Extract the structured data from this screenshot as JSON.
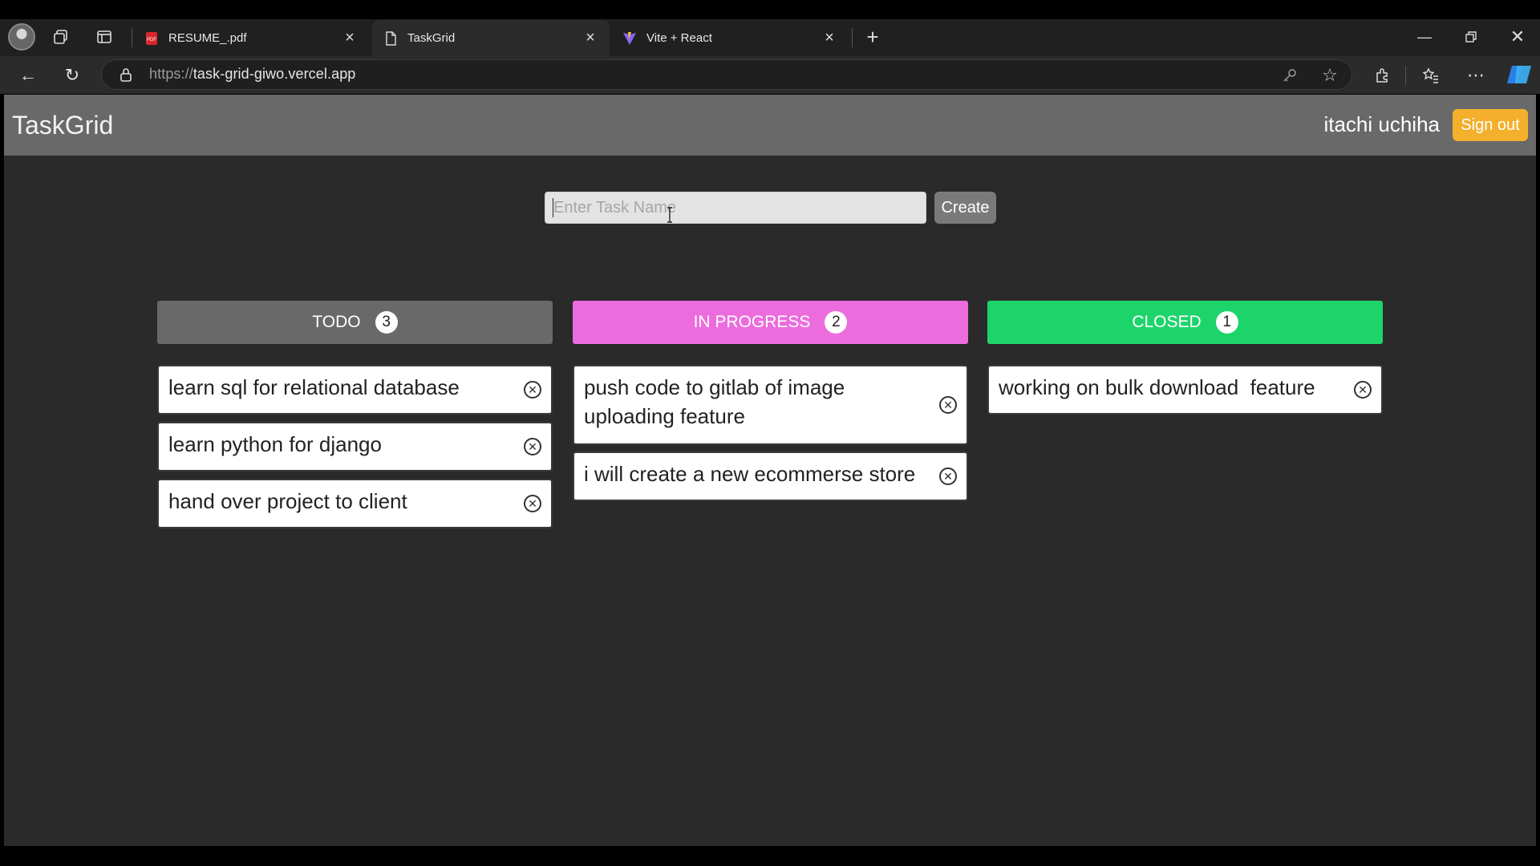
{
  "browser": {
    "tabs": [
      {
        "label": "RESUME_.pdf",
        "icon": "pdf-icon"
      },
      {
        "label": "TaskGrid",
        "icon": "page-icon"
      },
      {
        "label": "Vite + React",
        "icon": "vite-icon"
      }
    ],
    "url_protocol": "https://",
    "url_host": "task-grid-giwo.vercel.app"
  },
  "app": {
    "brand": "TaskGrid",
    "user_name": "itachi uchiha",
    "sign_out_label": "Sign out",
    "task_input": {
      "placeholder": "Enter Task Name",
      "value": ""
    },
    "create_label": "Create",
    "columns": [
      {
        "title": "TODO",
        "count": "3",
        "color": "#696969",
        "tasks": [
          "learn sql for relational database",
          "learn python for django",
          "hand over project to client"
        ]
      },
      {
        "title": "IN PROGRESS",
        "count": "2",
        "color": "#ec6cdd",
        "tasks": [
          "push code to gitlab of image uploading feature",
          "i will create a new ecommerse store"
        ]
      },
      {
        "title": "CLOSED",
        "count": "1",
        "color": "#1dd46a",
        "tasks": [
          "working on bulk download  feature"
        ]
      }
    ],
    "colors": {
      "header": "#696969",
      "sign_out": "#f4b02c",
      "background": "#2a2a2a"
    }
  }
}
